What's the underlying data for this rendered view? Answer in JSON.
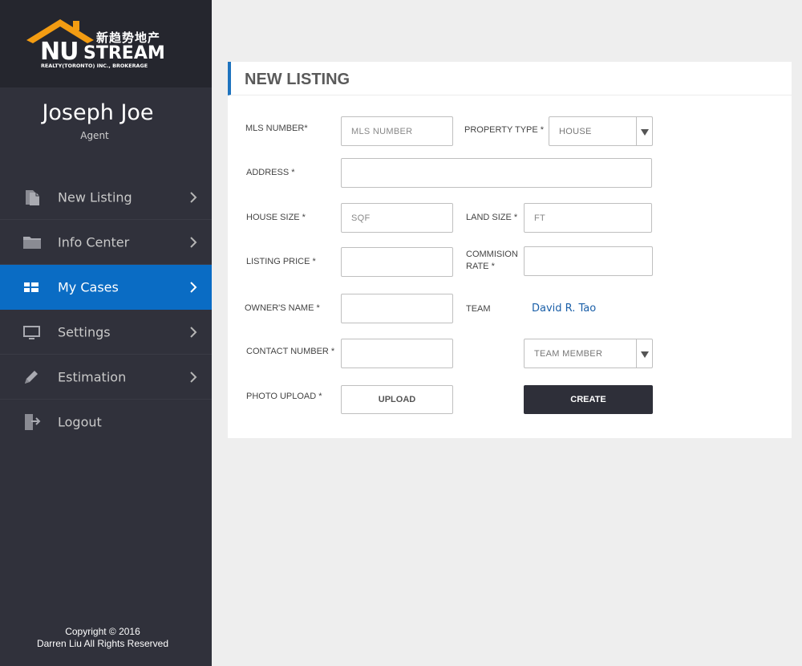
{
  "brand": {
    "logo_cn": "新趋势地产",
    "logo_nu": "NU",
    "logo_stream": "STREAM",
    "logo_sub": "REALTY(TORONTO) INC., BROKERAGE",
    "roof_color": "#f39c12"
  },
  "user": {
    "name": "Joseph Joe",
    "role": "Agent"
  },
  "nav": [
    {
      "label": "New Listing",
      "icon": "documents-icon",
      "active": false
    },
    {
      "label": "Info Center",
      "icon": "folder-icon",
      "active": false
    },
    {
      "label": "My Cases",
      "icon": "grid-icon",
      "active": true
    },
    {
      "label": "Settings",
      "icon": "monitor-icon",
      "active": false
    },
    {
      "label": "Estimation",
      "icon": "pencil-icon",
      "active": false
    },
    {
      "label": "Logout",
      "icon": "logout-icon",
      "active": false
    }
  ],
  "footer": {
    "line1": "Copyright © 2016",
    "line2": "Darren Liu All Rights Reserved"
  },
  "form": {
    "title": "NEW LISTING",
    "mls_label": "MLS  NUMBER*",
    "mls_placeholder": "MLS NUMBER",
    "property_type_label": "PROPERTY TYPE *",
    "property_type_value": "HOUSE",
    "address_label": "ADDRESS *",
    "house_size_label": "HOUSE SIZE *",
    "house_size_placeholder": "SQF",
    "land_size_label": "LAND SIZE *",
    "land_size_placeholder": "FT",
    "listing_price_label": "LISTING PRICE *",
    "commission_label_1": "COMMISION",
    "commission_label_2": "RATE *",
    "owner_label": "OWNER'S NAME *",
    "team_label": "TEAM",
    "team_value": "David R. Tao",
    "contact_label": "CONTACT NUMBER *",
    "team_member_value": "TEAM MEMBER",
    "photo_label": "PHOTO UPLOAD *",
    "upload_label": "UPLOAD",
    "create_label": "CREATE"
  },
  "colors": {
    "sidebar": "#30313b",
    "active": "#0a6cc4",
    "accent_bar": "#1e73be",
    "create_button": "#2e2f39"
  }
}
